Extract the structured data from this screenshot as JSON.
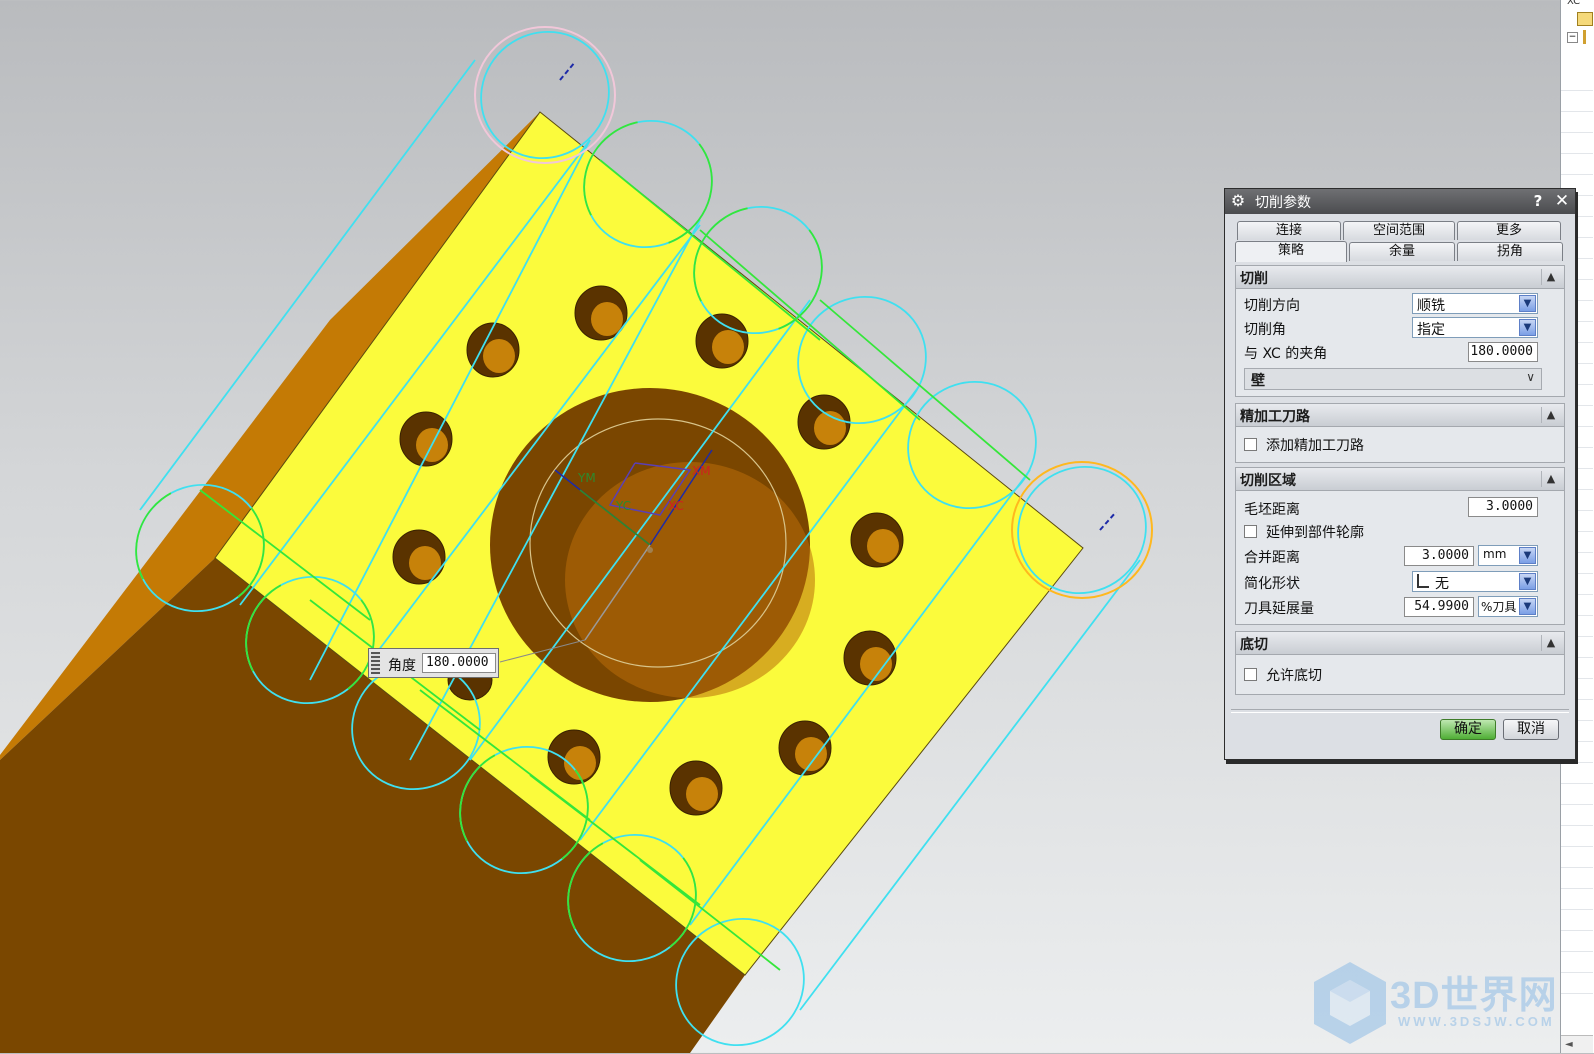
{
  "viewport": {
    "angle_input": {
      "label": "角度",
      "value": "180.0000"
    },
    "axis_labels": {
      "ym": "YM",
      "yc": "YC",
      "xm": "XM",
      "xc": "XC"
    },
    "colors": {
      "face_top": "#fbfb3c",
      "face_side": "#7a4700",
      "face_left": "#c47a05",
      "tool_cyan": "#3fe0f0",
      "tool_green": "#35e63a",
      "hole_dark": "#5a3300",
      "highlight_orange": "#ffb81e",
      "highlight_pink": "#f1c7d9"
    }
  },
  "watermark": {
    "text": "3D世界网",
    "url": "WWW.3DSJW.COM"
  },
  "side_panel": {
    "label": "XC",
    "scroll_left_icon": "arrow-left-icon"
  },
  "dialog": {
    "title": "切削参数",
    "help_icon": "?",
    "close_icon": "✕",
    "tabs_row1": [
      "连接",
      "空间范围",
      "更多"
    ],
    "tabs_row2": [
      "策略",
      "余量",
      "拐角"
    ],
    "active_tab": "策略",
    "sections": {
      "cut": {
        "title": "切削",
        "cut_direction_label": "切削方向",
        "cut_direction_value": "顺铣",
        "cut_angle_label": "切削角",
        "cut_angle_value": "指定",
        "xc_angle_label": "与 XC 的夹角",
        "xc_angle_value": "180.0000",
        "wall_label": "壁"
      },
      "finish": {
        "title": "精加工刀路",
        "add_finish_label": "添加精加工刀路"
      },
      "cut_region": {
        "title": "切削区域",
        "blank_distance_label": "毛坯距离",
        "blank_distance_value": "3.0000",
        "extend_label": "延伸到部件轮廓",
        "merge_distance_label": "合并距离",
        "merge_distance_value": "3.0000",
        "merge_unit": "mm",
        "simplify_label": "简化形状",
        "simplify_value": "无",
        "tool_extension_label": "刀具延展量",
        "tool_extension_value": "54.9900",
        "tool_extension_unit": "%刀具"
      },
      "undercut": {
        "title": "底切",
        "allow_label": "允许底切"
      }
    },
    "ok_label": "确定",
    "cancel_label": "取消"
  }
}
